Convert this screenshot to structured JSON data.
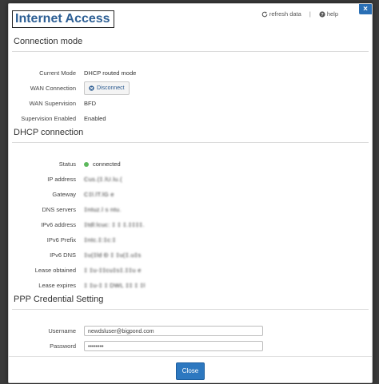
{
  "dialog": {
    "title": "Internet Access",
    "refresh_label": "refresh data",
    "divider": "|",
    "help_label": "help",
    "close_x": "×",
    "close_button": "Close"
  },
  "connection_mode": {
    "heading": "Connection mode",
    "rows": [
      {
        "label": "Current Mode",
        "value": "DHCP routed mode"
      },
      {
        "label": "WAN Connection",
        "value": "Disconnect"
      },
      {
        "label": "WAN Supervision",
        "value": "BFD"
      },
      {
        "label": "Supervision Enabled",
        "value": "Enabled"
      }
    ]
  },
  "dhcp": {
    "heading": "DHCP connection",
    "rows": [
      {
        "label": "Status",
        "value": "connected"
      },
      {
        "label": "IP address",
        "value": "Cus.(‡.lU.lu.("
      },
      {
        "label": "Gateway",
        "value": "C‡l.lT.lG e"
      },
      {
        "label": "DNS servers",
        "value": "‡ntuz.l s ntu."
      },
      {
        "label": "IPv6 address",
        "value": "‡tdl:lcuc: ‡     ‡ ‡.‡‡‡‡."
      },
      {
        "label": "IPv6 Prefix",
        "value": "‡ntc.‡:‡c:‡"
      },
      {
        "label": "IPv6 DNS",
        "value": "‡u(‡ld Ɖ ‡ ‡u(‡.u‡s"
      },
      {
        "label": "Lease obtained",
        "value": "‡ ‡u-‡‡cu‡s‡.‡‡u e"
      },
      {
        "label": "Lease expires",
        "value": "‡ ‡u-‡ ‡  DWL ‡‡ ‡ ‡l"
      }
    ],
    "status_color": "#5cb85c"
  },
  "ppp": {
    "heading": "PPP Credential Setting",
    "username_label": "Username",
    "username_value": "newdsluser@bigpond.com",
    "password_label": "Password",
    "password_value": "••••••••"
  },
  "colors": {
    "accent": "#2d78c0",
    "title": "#2d5f94"
  }
}
